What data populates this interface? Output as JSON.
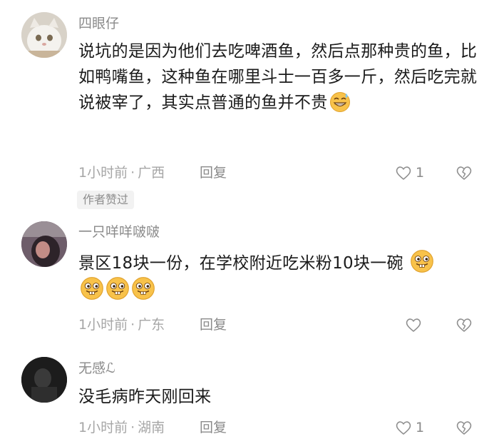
{
  "comments": [
    {
      "username": "四眼仔",
      "text": "说坑的是因为他们去吃啤酒鱼，然后点那种贵的鱼，比如鸭嘴鱼，这种鱼在哪里斗士一百多一斤，然后吃完就说被宰了，其实点普通的鱼并不贵",
      "emoji": [
        "sweat-grin"
      ],
      "time": "1小时前",
      "location": "广西",
      "reply_label": "回复",
      "likes": "1",
      "badge": "作者赞过"
    },
    {
      "username": "一只咩咩啵啵",
      "text": "景区18块一份，在学校附近吃米粉10块一碗",
      "emoji": [
        "bucktooth-grin",
        "bucktooth-grin",
        "bucktooth-grin",
        "bucktooth-grin"
      ],
      "time": "1小时前",
      "location": "广东",
      "reply_label": "回复",
      "likes": ""
    },
    {
      "username": "无感ℒ",
      "text": "没毛病昨天刚回来",
      "emoji": [],
      "time": "1小时前",
      "location": "湖南",
      "reply_label": "回复",
      "likes": "1"
    }
  ],
  "meta_separator": "·",
  "colors": {
    "emoji_yellow": "#f8c24a",
    "meta_gray": "#a6a6a6",
    "badge_bg": "#f2f2f2"
  }
}
